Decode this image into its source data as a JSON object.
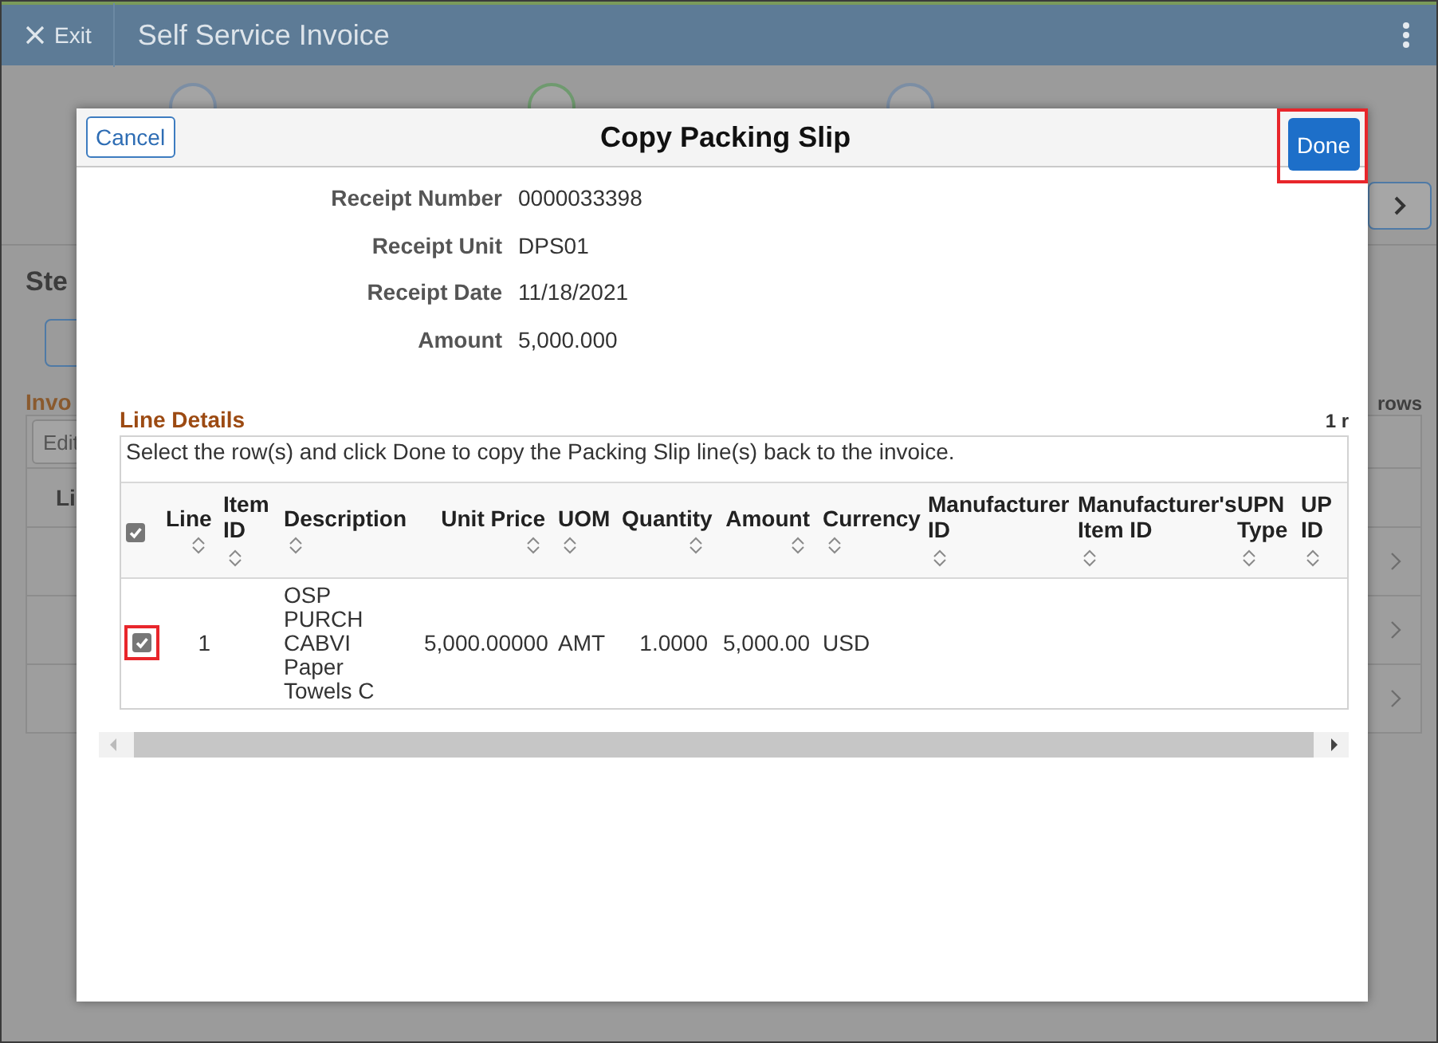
{
  "app_bar": {
    "exit_label": "Exit",
    "title": "Self Service Invoice"
  },
  "steps": [
    {
      "selected": false
    },
    {
      "selected": true
    },
    {
      "selected": false
    }
  ],
  "page": {
    "heading": "Ste",
    "section_title": "Invo",
    "row_count": "rows",
    "edit_button": "Edit",
    "column_1": "Li"
  },
  "dialog": {
    "title": "Copy Packing Slip",
    "cancel_button": "Cancel",
    "done_button": "Done",
    "fields": [
      {
        "label": "Receipt Number",
        "value": "0000033398"
      },
      {
        "label": "Receipt Unit",
        "value": "DPS01"
      },
      {
        "label": "Receipt Date",
        "value": "11/18/2021"
      },
      {
        "label": "Amount",
        "value": "5,000.000"
      }
    ],
    "section_title": "Line Details",
    "row_count": "1 r",
    "instruction": "Select the row(s) and click Done to copy the Packing Slip line(s) back to the invoice.",
    "select_all_checked": true,
    "columns": [
      {
        "label": "Line",
        "kind": "number"
      },
      {
        "label": "Item ID",
        "kind": "text"
      },
      {
        "label": "Description",
        "kind": "text"
      },
      {
        "label": "Unit Price",
        "kind": "number"
      },
      {
        "label": "UOM",
        "kind": "text"
      },
      {
        "label": "Quantity",
        "kind": "number"
      },
      {
        "label": "Amount",
        "kind": "number"
      },
      {
        "label": "Currency",
        "kind": "text"
      },
      {
        "label": "Manufacturer ID",
        "kind": "text"
      },
      {
        "label": "Manufacturer's Item ID",
        "kind": "text"
      },
      {
        "label": "UPN Type",
        "kind": "text"
      },
      {
        "label": "UP ID",
        "kind": "text"
      }
    ],
    "rows": [
      {
        "checked": true,
        "cells": [
          "1",
          null,
          "OSP PURCH CABVI Paper Towels C",
          "5,000.00000",
          "AMT",
          "1.0000",
          "5,000.00",
          "USD"
        ]
      }
    ]
  }
}
